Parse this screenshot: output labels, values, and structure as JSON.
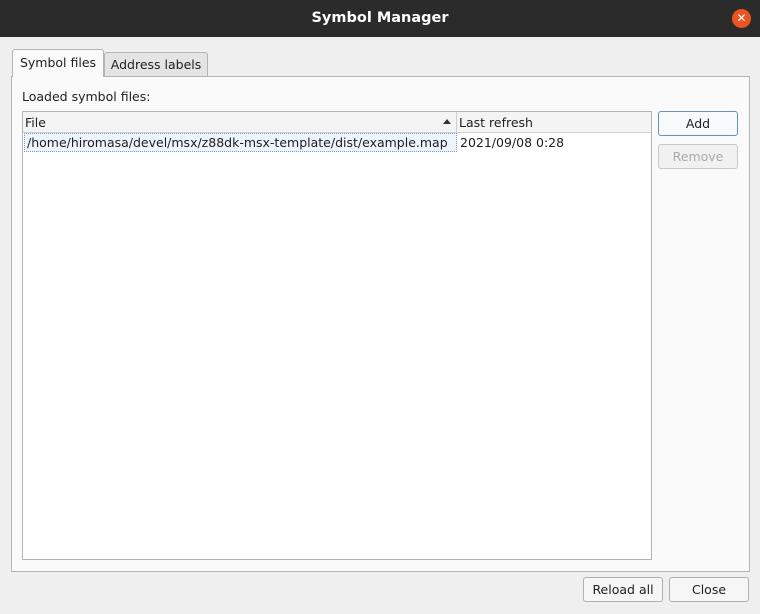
{
  "window": {
    "title": "Symbol Manager"
  },
  "tabs": [
    {
      "label": "Symbol files",
      "active": true
    },
    {
      "label": "Address labels",
      "active": false
    }
  ],
  "symbol_files": {
    "label": "Loaded symbol files:",
    "columns": [
      "File",
      "Last refresh"
    ],
    "sort": {
      "column": "File",
      "direction": "ascending"
    },
    "rows": [
      {
        "file": "/home/hiromasa/devel/msx/z88dk-msx-template/dist/example.map",
        "last_refresh": "2021/09/08 0:28"
      }
    ],
    "buttons": {
      "add": "Add",
      "remove": "Remove"
    }
  },
  "footer": {
    "reload_all": "Reload all",
    "close": "Close"
  },
  "colors": {
    "titlebar": "#2b2b2b",
    "close_button": "#e95420",
    "selection": "#eef4fb"
  }
}
